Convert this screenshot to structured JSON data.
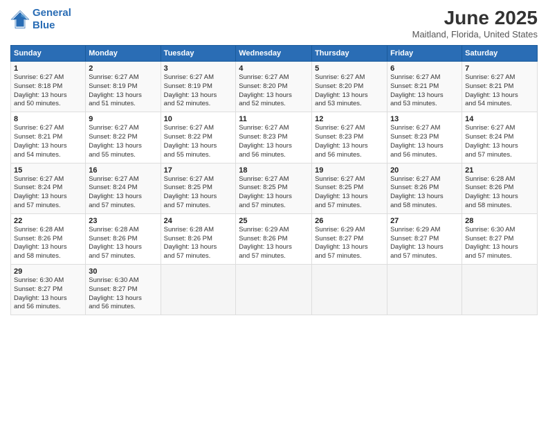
{
  "logo": {
    "line1": "General",
    "line2": "Blue"
  },
  "title": "June 2025",
  "subtitle": "Maitland, Florida, United States",
  "weekdays": [
    "Sunday",
    "Monday",
    "Tuesday",
    "Wednesday",
    "Thursday",
    "Friday",
    "Saturday"
  ],
  "weeks": [
    [
      {
        "day": "1",
        "sunrise": "6:27 AM",
        "sunset": "8:18 PM",
        "daylight": "13 hours and 50 minutes."
      },
      {
        "day": "2",
        "sunrise": "6:27 AM",
        "sunset": "8:19 PM",
        "daylight": "13 hours and 51 minutes."
      },
      {
        "day": "3",
        "sunrise": "6:27 AM",
        "sunset": "8:19 PM",
        "daylight": "13 hours and 52 minutes."
      },
      {
        "day": "4",
        "sunrise": "6:27 AM",
        "sunset": "8:20 PM",
        "daylight": "13 hours and 52 minutes."
      },
      {
        "day": "5",
        "sunrise": "6:27 AM",
        "sunset": "8:20 PM",
        "daylight": "13 hours and 53 minutes."
      },
      {
        "day": "6",
        "sunrise": "6:27 AM",
        "sunset": "8:21 PM",
        "daylight": "13 hours and 53 minutes."
      },
      {
        "day": "7",
        "sunrise": "6:27 AM",
        "sunset": "8:21 PM",
        "daylight": "13 hours and 54 minutes."
      }
    ],
    [
      {
        "day": "8",
        "sunrise": "6:27 AM",
        "sunset": "8:21 PM",
        "daylight": "13 hours and 54 minutes."
      },
      {
        "day": "9",
        "sunrise": "6:27 AM",
        "sunset": "8:22 PM",
        "daylight": "13 hours and 55 minutes."
      },
      {
        "day": "10",
        "sunrise": "6:27 AM",
        "sunset": "8:22 PM",
        "daylight": "13 hours and 55 minutes."
      },
      {
        "day": "11",
        "sunrise": "6:27 AM",
        "sunset": "8:23 PM",
        "daylight": "13 hours and 56 minutes."
      },
      {
        "day": "12",
        "sunrise": "6:27 AM",
        "sunset": "8:23 PM",
        "daylight": "13 hours and 56 minutes."
      },
      {
        "day": "13",
        "sunrise": "6:27 AM",
        "sunset": "8:23 PM",
        "daylight": "13 hours and 56 minutes."
      },
      {
        "day": "14",
        "sunrise": "6:27 AM",
        "sunset": "8:24 PM",
        "daylight": "13 hours and 57 minutes."
      }
    ],
    [
      {
        "day": "15",
        "sunrise": "6:27 AM",
        "sunset": "8:24 PM",
        "daylight": "13 hours and 57 minutes."
      },
      {
        "day": "16",
        "sunrise": "6:27 AM",
        "sunset": "8:24 PM",
        "daylight": "13 hours and 57 minutes."
      },
      {
        "day": "17",
        "sunrise": "6:27 AM",
        "sunset": "8:25 PM",
        "daylight": "13 hours and 57 minutes."
      },
      {
        "day": "18",
        "sunrise": "6:27 AM",
        "sunset": "8:25 PM",
        "daylight": "13 hours and 57 minutes."
      },
      {
        "day": "19",
        "sunrise": "6:27 AM",
        "sunset": "8:25 PM",
        "daylight": "13 hours and 57 minutes."
      },
      {
        "day": "20",
        "sunrise": "6:27 AM",
        "sunset": "8:26 PM",
        "daylight": "13 hours and 58 minutes."
      },
      {
        "day": "21",
        "sunrise": "6:28 AM",
        "sunset": "8:26 PM",
        "daylight": "13 hours and 58 minutes."
      }
    ],
    [
      {
        "day": "22",
        "sunrise": "6:28 AM",
        "sunset": "8:26 PM",
        "daylight": "13 hours and 58 minutes."
      },
      {
        "day": "23",
        "sunrise": "6:28 AM",
        "sunset": "8:26 PM",
        "daylight": "13 hours and 57 minutes."
      },
      {
        "day": "24",
        "sunrise": "6:28 AM",
        "sunset": "8:26 PM",
        "daylight": "13 hours and 57 minutes."
      },
      {
        "day": "25",
        "sunrise": "6:29 AM",
        "sunset": "8:26 PM",
        "daylight": "13 hours and 57 minutes."
      },
      {
        "day": "26",
        "sunrise": "6:29 AM",
        "sunset": "8:27 PM",
        "daylight": "13 hours and 57 minutes."
      },
      {
        "day": "27",
        "sunrise": "6:29 AM",
        "sunset": "8:27 PM",
        "daylight": "13 hours and 57 minutes."
      },
      {
        "day": "28",
        "sunrise": "6:30 AM",
        "sunset": "8:27 PM",
        "daylight": "13 hours and 57 minutes."
      }
    ],
    [
      {
        "day": "29",
        "sunrise": "6:30 AM",
        "sunset": "8:27 PM",
        "daylight": "13 hours and 56 minutes."
      },
      {
        "day": "30",
        "sunrise": "6:30 AM",
        "sunset": "8:27 PM",
        "daylight": "13 hours and 56 minutes."
      },
      null,
      null,
      null,
      null,
      null
    ]
  ]
}
